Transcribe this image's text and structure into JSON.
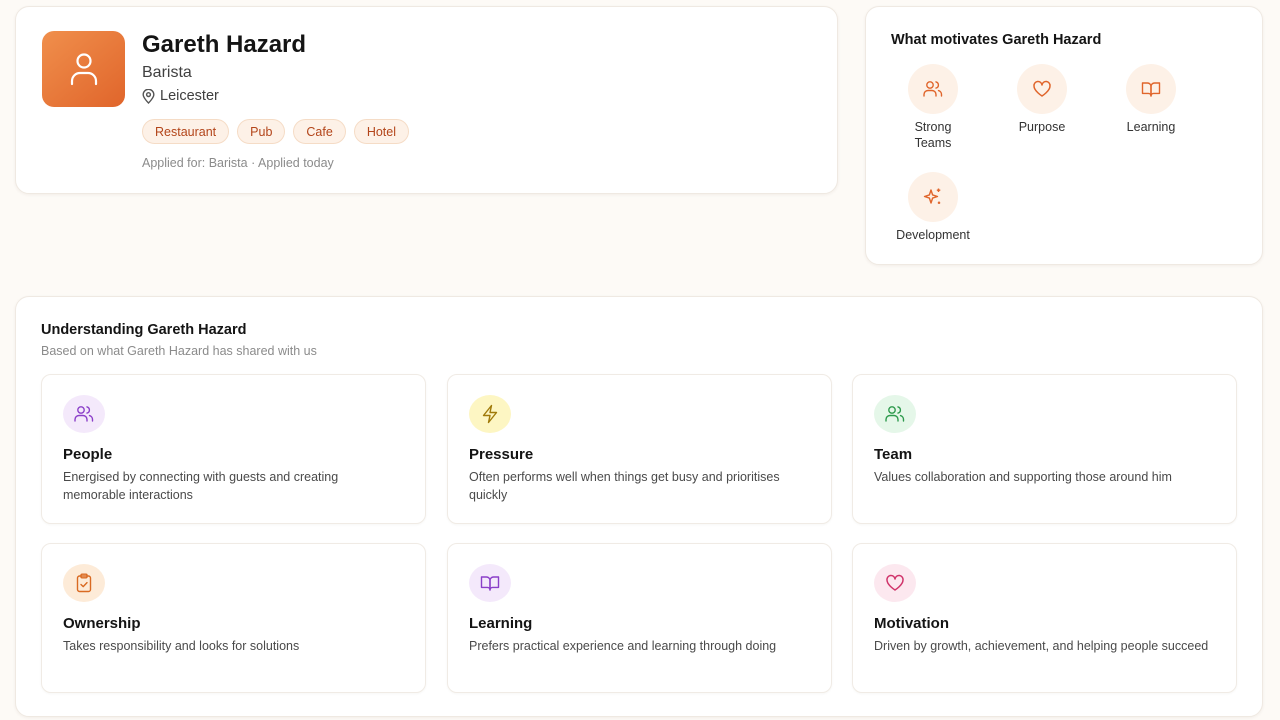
{
  "profile": {
    "name": "Gareth Hazard",
    "role": "Barista",
    "location": "Leicester",
    "tags": [
      "Restaurant",
      "Pub",
      "Cafe",
      "Hotel"
    ],
    "applied": "Applied for: Barista · Applied today",
    "avatar_icon": "user-icon",
    "avatar_gradient": [
      "#f08f4c",
      "#e0652b"
    ]
  },
  "motivates": {
    "title": "What motivates Gareth Hazard",
    "items": [
      {
        "label": "Strong\nTeams",
        "icon": "users-icon"
      },
      {
        "label": "Purpose",
        "icon": "heart-icon"
      },
      {
        "label": "Learning",
        "icon": "book-open-icon"
      },
      {
        "label": "Development",
        "icon": "sparkles-icon"
      }
    ],
    "icon_color": "#e0652b",
    "circle_color": "#fdf1e7"
  },
  "understanding": {
    "title": "Understanding Gareth Hazard",
    "subtitle": "Based on what Gareth Hazard has shared with us",
    "traits": [
      {
        "title": "People",
        "desc": "Energised by connecting with guests and creating memorable interactions",
        "icon": "users-icon",
        "color": "#8b3fc9",
        "bg": "#f4e9fb"
      },
      {
        "title": "Pressure",
        "desc": "Often performs well when things get busy and prioritises quickly",
        "icon": "zap-icon",
        "color": "#a07a0a",
        "bg": "#fdf6c3"
      },
      {
        "title": "Team",
        "desc": "Values collaboration and supporting those around him",
        "icon": "user-check-icon",
        "color": "#2e9a4d",
        "bg": "#e5f7e9"
      },
      {
        "title": "Ownership",
        "desc": "Takes responsibility and looks for solutions",
        "icon": "clipboard-check-icon",
        "color": "#d96a22",
        "bg": "#fdebd8"
      },
      {
        "title": "Learning",
        "desc": "Prefers practical experience and learning through doing",
        "icon": "book-open-icon",
        "color": "#8b3fc9",
        "bg": "#f4e9fb"
      },
      {
        "title": "Motivation",
        "desc": "Driven by growth, achievement, and helping people succeed",
        "icon": "heart-icon",
        "color": "#d0336a",
        "bg": "#fce8ef"
      }
    ]
  }
}
